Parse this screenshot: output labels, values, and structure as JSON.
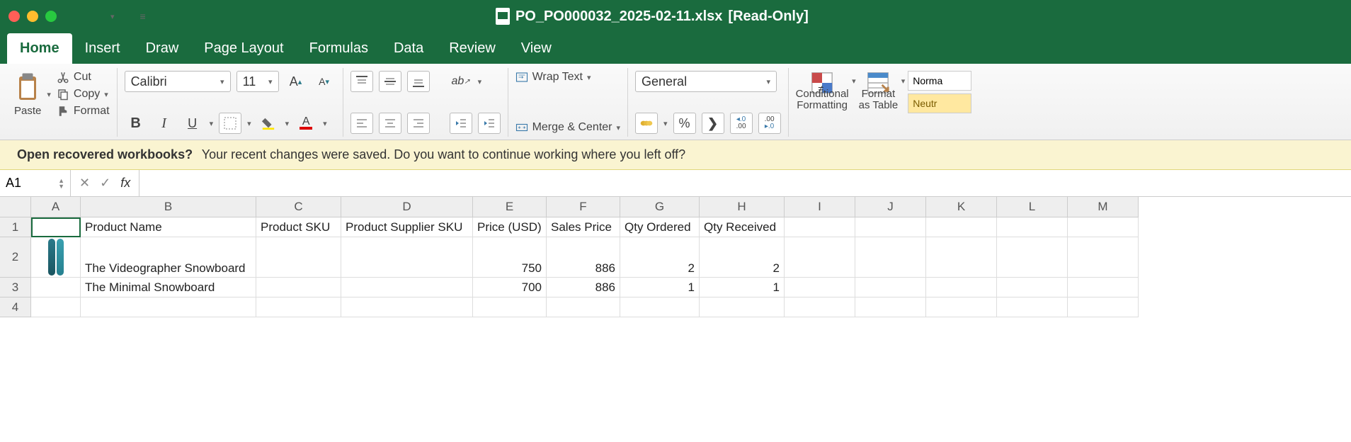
{
  "titlebar": {
    "filename": "PO_PO000032_2025-02-11.xlsx",
    "readonly": "[Read-Only]"
  },
  "tabs": {
    "home": "Home",
    "insert": "Insert",
    "draw": "Draw",
    "page_layout": "Page Layout",
    "formulas": "Formulas",
    "data": "Data",
    "review": "Review",
    "view": "View"
  },
  "ribbon": {
    "paste": "Paste",
    "cut": "Cut",
    "copy": "Copy",
    "format": "Format",
    "font_name": "Calibri",
    "font_size": "11",
    "wrap_text": "Wrap Text",
    "merge_center": "Merge & Center",
    "number_format": "General",
    "percent": "%",
    "comma": "❯",
    "inc_dec_1": ".0",
    "inc_dec_2": ".00",
    "conditional": "Conditional",
    "formatting": "Formatting",
    "format_btn": "Format",
    "as_table": "as Table",
    "style_normal": "Norma",
    "style_neutral": "Neutr"
  },
  "msgbar": {
    "title": "Open recovered workbooks?",
    "body": "Your recent changes were saved. Do you want to continue working where you left off?"
  },
  "formula": {
    "cellref": "A1",
    "fx": "fx",
    "value": ""
  },
  "columns": [
    "A",
    "B",
    "C",
    "D",
    "E",
    "F",
    "G",
    "H",
    "I",
    "J",
    "K",
    "L",
    "M"
  ],
  "headers": {
    "B": "Product Name",
    "C": "Product SKU",
    "D": "Product Supplier SKU",
    "E": "Price (USD)",
    "F": "Sales Price",
    "G": "Qty Ordered",
    "H": "Qty Received"
  },
  "rows": [
    {
      "no": "2",
      "B": "The Videographer Snowboard",
      "E": "750",
      "F": "886",
      "G": "2",
      "H": "2"
    },
    {
      "no": "3",
      "B": "The Minimal Snowboard",
      "E": "700",
      "F": "886",
      "G": "1",
      "H": "1"
    }
  ],
  "rownum1": "1",
  "rownum4": "4",
  "chart_data": {
    "type": "table",
    "columns": [
      "Product Name",
      "Product SKU",
      "Product Supplier SKU",
      "Price (USD)",
      "Sales Price",
      "Qty Ordered",
      "Qty Received"
    ],
    "data": [
      [
        "The Videographer Snowboard",
        "",
        "",
        750,
        886,
        2,
        2
      ],
      [
        "The Minimal Snowboard",
        "",
        "",
        700,
        886,
        1,
        1
      ]
    ]
  }
}
